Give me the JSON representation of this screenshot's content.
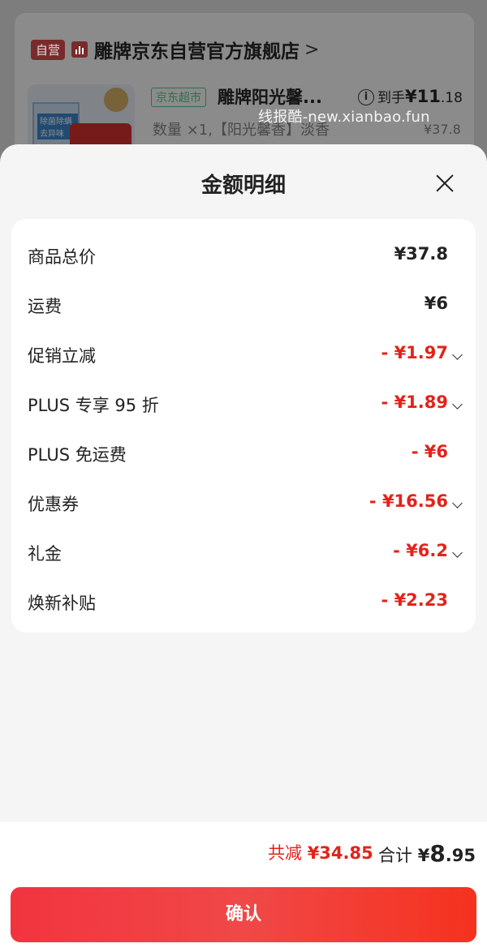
{
  "background": {
    "store_tag": "自营",
    "store_name": "雕牌京东自营官方旗舰店",
    "store_arrow": ">",
    "supermarket_tag": "京东超市",
    "product_title": "雕牌阳光馨...",
    "arrive_label": "到手",
    "arrive_price_main": "¥11",
    "arrive_price_cents": ".18",
    "product_meta": "数量 ×1,【阳光馨香】淡香",
    "product_original_price": "¥37.8",
    "image_text": "除菌除螨 去异味",
    "watermark": "线报酷-new.xianbao.fun"
  },
  "sheet": {
    "title": "金额明细",
    "rows": [
      {
        "label": "商品总价",
        "value": "¥37.8",
        "red": false,
        "expand": false
      },
      {
        "label": "运费",
        "value": "¥6",
        "red": false,
        "expand": false
      },
      {
        "label": "促销立减",
        "value": "- ¥1.97",
        "red": true,
        "expand": true
      },
      {
        "label": "PLUS 专享 95 折",
        "value": "- ¥1.89",
        "red": true,
        "expand": true
      },
      {
        "label": "PLUS 免运费",
        "value": "- ¥6",
        "red": true,
        "expand": false
      },
      {
        "label": "优惠券",
        "value": "- ¥16.56",
        "red": true,
        "expand": true
      },
      {
        "label": "礼金",
        "value": "- ¥6.2",
        "red": true,
        "expand": true
      },
      {
        "label": "焕新补贴",
        "value": "- ¥2.23",
        "red": true,
        "expand": false
      }
    ]
  },
  "footer": {
    "reduce_label": "共减",
    "reduce_value": "¥34.85",
    "total_label": "合计",
    "total_yen": "¥",
    "total_int": "8",
    "total_dec": ".95"
  },
  "confirm_label": "确认",
  "colors": {
    "accent_red": "#e2231a",
    "button_red": "#f2343f",
    "supermarket_green": "#3aa870"
  }
}
